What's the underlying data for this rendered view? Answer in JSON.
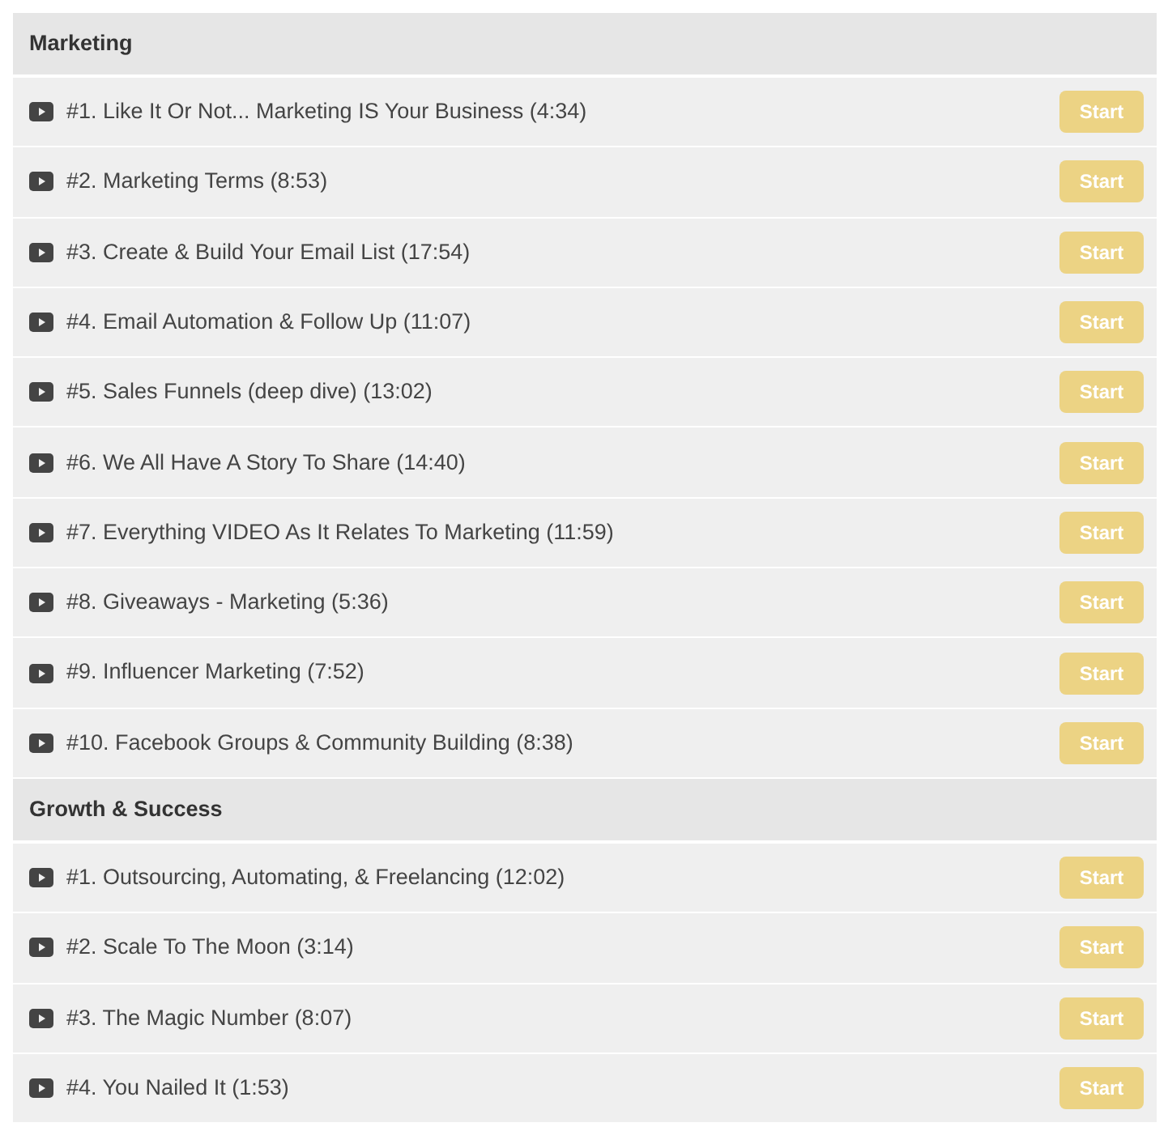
{
  "sections": [
    {
      "title": "Marketing",
      "lessons": [
        {
          "title": "#1. Like It Or Not... Marketing IS Your Business (4:34)",
          "button": "Start"
        },
        {
          "title": "#2. Marketing Terms (8:53)",
          "button": "Start"
        },
        {
          "title": "#3. Create & Build Your Email List (17:54)",
          "button": "Start"
        },
        {
          "title": "#4. Email Automation & Follow Up (11:07)",
          "button": "Start"
        },
        {
          "title": "#5. Sales Funnels (deep dive) (13:02)",
          "button": "Start"
        },
        {
          "title": "#6. We All Have A Story To Share (14:40)",
          "button": "Start"
        },
        {
          "title": "#7. Everything VIDEO As It Relates To Marketing (11:59)",
          "button": "Start"
        },
        {
          "title": "#8. Giveaways - Marketing (5:36)",
          "button": "Start"
        },
        {
          "title": "#9. Influencer Marketing (7:52)",
          "button": "Start"
        },
        {
          "title": "#10. Facebook Groups & Community Building (8:38)",
          "button": "Start"
        }
      ]
    },
    {
      "title": "Growth & Success",
      "lessons": [
        {
          "title": "#1. Outsourcing, Automating, & Freelancing (12:02)",
          "button": "Start"
        },
        {
          "title": "#2. Scale To The Moon (3:14)",
          "button": "Start"
        },
        {
          "title": "#3. The Magic Number (8:07)",
          "button": "Start"
        },
        {
          "title": "#4. You Nailed It (1:53)",
          "button": "Start"
        }
      ]
    }
  ]
}
